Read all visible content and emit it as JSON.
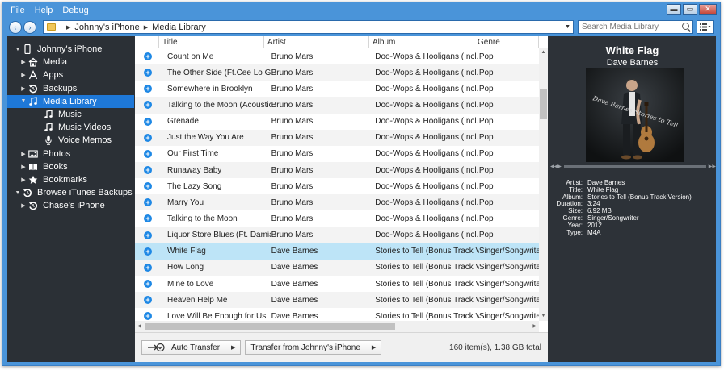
{
  "menu": [
    "File",
    "Help",
    "Debug"
  ],
  "window_controls": {
    "minimize": "▬",
    "maximize": "▭",
    "close": "✕"
  },
  "nav": {
    "back": "‹",
    "forward": "›"
  },
  "breadcrumb": [
    "Johnny's iPhone",
    "Media Library"
  ],
  "search": {
    "placeholder": "Search Media Library"
  },
  "sidebar": {
    "items": [
      {
        "label": "Johnny's iPhone",
        "icon": "phone-icon",
        "expander": "▼",
        "level": 0
      },
      {
        "label": "Media",
        "icon": "home-icon",
        "expander": "▶",
        "level": 1
      },
      {
        "label": "Apps",
        "icon": "apps-icon",
        "expander": "▶",
        "level": 1
      },
      {
        "label": "Backups",
        "icon": "backup-icon",
        "expander": "▶",
        "level": 1
      },
      {
        "label": "Media Library",
        "icon": "music-note-icon",
        "expander": "▼",
        "level": 1,
        "selected": true
      },
      {
        "label": "Music",
        "icon": "music-note-icon",
        "expander": "",
        "level": 2
      },
      {
        "label": "Music Videos",
        "icon": "music-note-icon",
        "expander": "",
        "level": 2
      },
      {
        "label": "Voice Memos",
        "icon": "microphone-icon",
        "expander": "",
        "level": 2
      },
      {
        "label": "Photos",
        "icon": "photo-icon",
        "expander": "▶",
        "level": 1
      },
      {
        "label": "Books",
        "icon": "book-icon",
        "expander": "▶",
        "level": 1
      },
      {
        "label": "Bookmarks",
        "icon": "star-icon",
        "expander": "▶",
        "level": 1
      },
      {
        "label": "Browse iTunes Backups",
        "icon": "backup-icon",
        "expander": "▼",
        "level": 0
      },
      {
        "label": "Chase's iPhone",
        "icon": "backup-icon",
        "expander": "▶",
        "level": 1
      }
    ]
  },
  "list": {
    "columns": [
      "Title",
      "Artist",
      "Album",
      "Genre"
    ],
    "rows": [
      {
        "title": "Count on Me",
        "artist": "Bruno Mars",
        "album": "Doo-Wops & Hooligans (Incl. Bon",
        "genre": "Pop"
      },
      {
        "title": "The Other Side (Ft.Cee Lo Green &",
        "artist": "Bruno Mars",
        "album": "Doo-Wops & Hooligans (Incl. Bon",
        "genre": "Pop"
      },
      {
        "title": "Somewhere in Brooklyn",
        "artist": "Bruno Mars",
        "album": "Doo-Wops & Hooligans (Incl. Bon",
        "genre": "Pop"
      },
      {
        "title": "Talking to the Moon (Acoustic Pia",
        "artist": "Bruno Mars",
        "album": "Doo-Wops & Hooligans (Incl. Bon",
        "genre": "Pop"
      },
      {
        "title": "Grenade",
        "artist": "Bruno Mars",
        "album": "Doo-Wops & Hooligans (Incl. Bon",
        "genre": "Pop"
      },
      {
        "title": "Just the Way You Are",
        "artist": "Bruno Mars",
        "album": "Doo-Wops & Hooligans (Incl. Bon",
        "genre": "Pop"
      },
      {
        "title": "Our First Time",
        "artist": "Bruno Mars",
        "album": "Doo-Wops & Hooligans (Incl. Bon",
        "genre": "Pop"
      },
      {
        "title": "Runaway Baby",
        "artist": "Bruno Mars",
        "album": "Doo-Wops & Hooligans (Incl. Bon",
        "genre": "Pop"
      },
      {
        "title": "The Lazy Song",
        "artist": "Bruno Mars",
        "album": "Doo-Wops & Hooligans (Incl. Bon",
        "genre": "Pop"
      },
      {
        "title": "Marry You",
        "artist": "Bruno Mars",
        "album": "Doo-Wops & Hooligans (Incl. Bon",
        "genre": "Pop"
      },
      {
        "title": "Talking to the Moon",
        "artist": "Bruno Mars",
        "album": "Doo-Wops & Hooligans (Incl. Bon",
        "genre": "Pop"
      },
      {
        "title": "Liquor Store Blues (Ft. Damian Ma",
        "artist": "Bruno Mars",
        "album": "Doo-Wops & Hooligans (Incl. Bon",
        "genre": "Pop"
      },
      {
        "title": "White Flag",
        "artist": "Dave Barnes",
        "album": "Stories to Tell (Bonus Track Versio",
        "genre": "Singer/Songwriter",
        "selected": true
      },
      {
        "title": "How Long",
        "artist": "Dave Barnes",
        "album": "Stories to Tell (Bonus Track Versio",
        "genre": "Singer/Songwriter"
      },
      {
        "title": "Mine to Love",
        "artist": "Dave Barnes",
        "album": "Stories to Tell (Bonus Track Versio",
        "genre": "Singer/Songwriter"
      },
      {
        "title": "Heaven Help Me",
        "artist": "Dave Barnes",
        "album": "Stories to Tell (Bonus Track Versio",
        "genre": "Singer/Songwriter"
      },
      {
        "title": "Love Will Be Enough for Us",
        "artist": "Dave Barnes",
        "album": "Stories to Tell (Bonus Track Versio",
        "genre": "Singer/Songwriter"
      }
    ]
  },
  "toolbar": {
    "auto_transfer": "Auto Transfer",
    "transfer_from": "Transfer from Johnny's iPhone",
    "status": "160 item(s), 1.38 GB total"
  },
  "detail": {
    "title": "White Flag",
    "artist": "Dave Barnes",
    "artwork_text": "Dave Barnes Stories to Tell",
    "info": [
      {
        "key": "Artist:",
        "value": "Dave Barnes"
      },
      {
        "key": "Title:",
        "value": "White Flag"
      },
      {
        "key": "Album:",
        "value": "Stories to Tell (Bonus Track Version)"
      },
      {
        "key": "Duration:",
        "value": "3:24"
      },
      {
        "key": "Size:",
        "value": "6.92 MB"
      },
      {
        "key": "Genre:",
        "value": "Singer/Songwriter"
      },
      {
        "key": "Year:",
        "value": "2012"
      },
      {
        "key": "Type:",
        "value": "M4A"
      }
    ]
  },
  "colors": {
    "accent": "#1e78d8",
    "frame": "#4a94d9",
    "sidebar": "#2b3036",
    "selected_row": "#bde4f7"
  }
}
